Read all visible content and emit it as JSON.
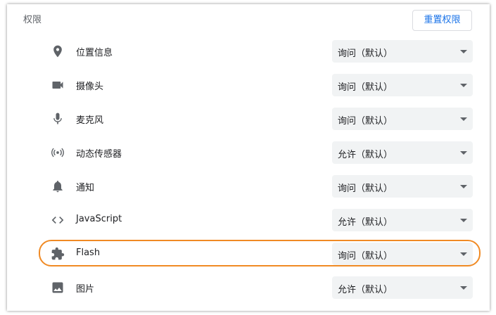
{
  "section": {
    "title": "权限"
  },
  "reset_button": {
    "label": "重置权限"
  },
  "permissions": [
    {
      "label": "位置信息",
      "value": "询问（默认）",
      "icon": "location-pin-icon"
    },
    {
      "label": "摄像头",
      "value": "询问（默认）",
      "icon": "camera-icon"
    },
    {
      "label": "麦克风",
      "value": "询问（默认）",
      "icon": "microphone-icon"
    },
    {
      "label": "动态传感器",
      "value": "允许（默认）",
      "icon": "motion-sensor-icon"
    },
    {
      "label": "通知",
      "value": "询问（默认）",
      "icon": "bell-icon"
    },
    {
      "label": "JavaScript",
      "value": "允许（默认）",
      "icon": "code-icon"
    },
    {
      "label": "Flash",
      "value": "询问（默认）",
      "icon": "puzzle-icon"
    },
    {
      "label": "图片",
      "value": "允许（默认）",
      "icon": "image-icon"
    }
  ],
  "highlight": {
    "target": "Flash",
    "color": "#f08a24"
  },
  "colors": {
    "accent": "#1a73e8",
    "icon": "#5f6368",
    "select_bg": "#f1f3f4"
  }
}
